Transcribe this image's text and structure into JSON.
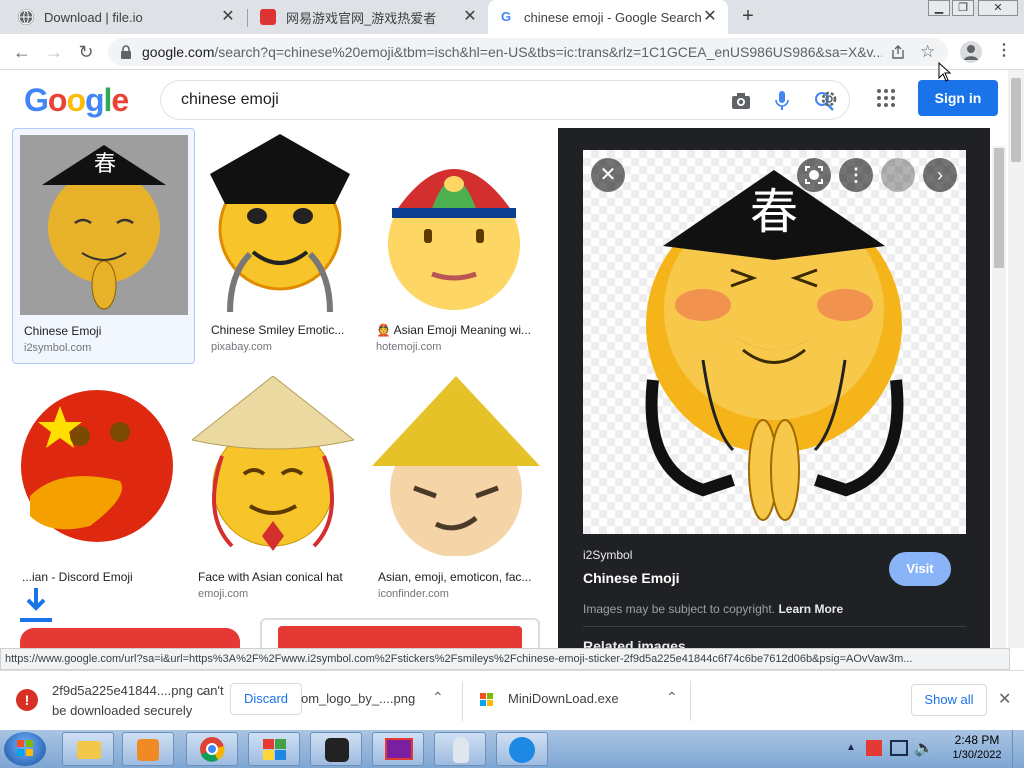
{
  "browser": {
    "tabs": [
      {
        "title": "Download | file.io",
        "icon": "globe-icon",
        "active": false
      },
      {
        "title": "网易游戏官网_游戏热爱者",
        "icon": "netease-icon",
        "active": false
      },
      {
        "title": "chinese emoji - Google Search",
        "icon": "google-icon",
        "active": true
      }
    ],
    "url": {
      "host": "google.com",
      "path": "/search?q=chinese%20emoji&tbm=isch&hl=en-US&tbs=ic:trans&rlz=1C1GCEA_enUS986US986&sa=X&v..."
    }
  },
  "google": {
    "logo": "Google",
    "query": "chinese emoji",
    "signin": "Sign in"
  },
  "results": [
    {
      "title": "Chinese Emoji",
      "source": "i2symbol.com"
    },
    {
      "title": "Chinese Smiley Emotic...",
      "source": "pixabay.com"
    },
    {
      "title": "👲 Asian Emoji Meaning wi...",
      "source": "hotemoji.com"
    },
    {
      "title": "...ian - Discord Emoji",
      "source": ""
    },
    {
      "title": "Face with Asian conical hat",
      "source": "emoji.com"
    },
    {
      "title": "Asian, emoji, emoticon, fac...",
      "source": "iconfinder.com"
    }
  ],
  "preview": {
    "source": "i2Symbol",
    "title": "Chinese Emoji",
    "visit": "Visit",
    "copyright": "Images may be subject to copyright.",
    "learn_more": "Learn More",
    "related": "Related images",
    "hat_char": "春"
  },
  "status_url": "https://www.google.com/url?sa=i&url=https%3A%2F%2Fwww.i2symbol.com%2Fstickers%2Fsmileys%2Fchinese-emoji-sticker-2f9d5a225e41844c6f74c6be7612d06b&psig=AOvVaw3m...",
  "downloads": {
    "item1_line1": "2f9d5a225e41844....png can't",
    "item1_line2": "be downloaded securely",
    "discard": "Discard",
    "item2": "om_logo_by_....png",
    "item3": "MiniDownLoad.exe",
    "show_all": "Show all"
  },
  "taskbar": {
    "time": "2:48 PM",
    "date": "1/30/2022"
  },
  "colors": {
    "accent": "#1a73e8",
    "emoji_yellow": "#f7c42a",
    "panel_bg": "#202124"
  }
}
